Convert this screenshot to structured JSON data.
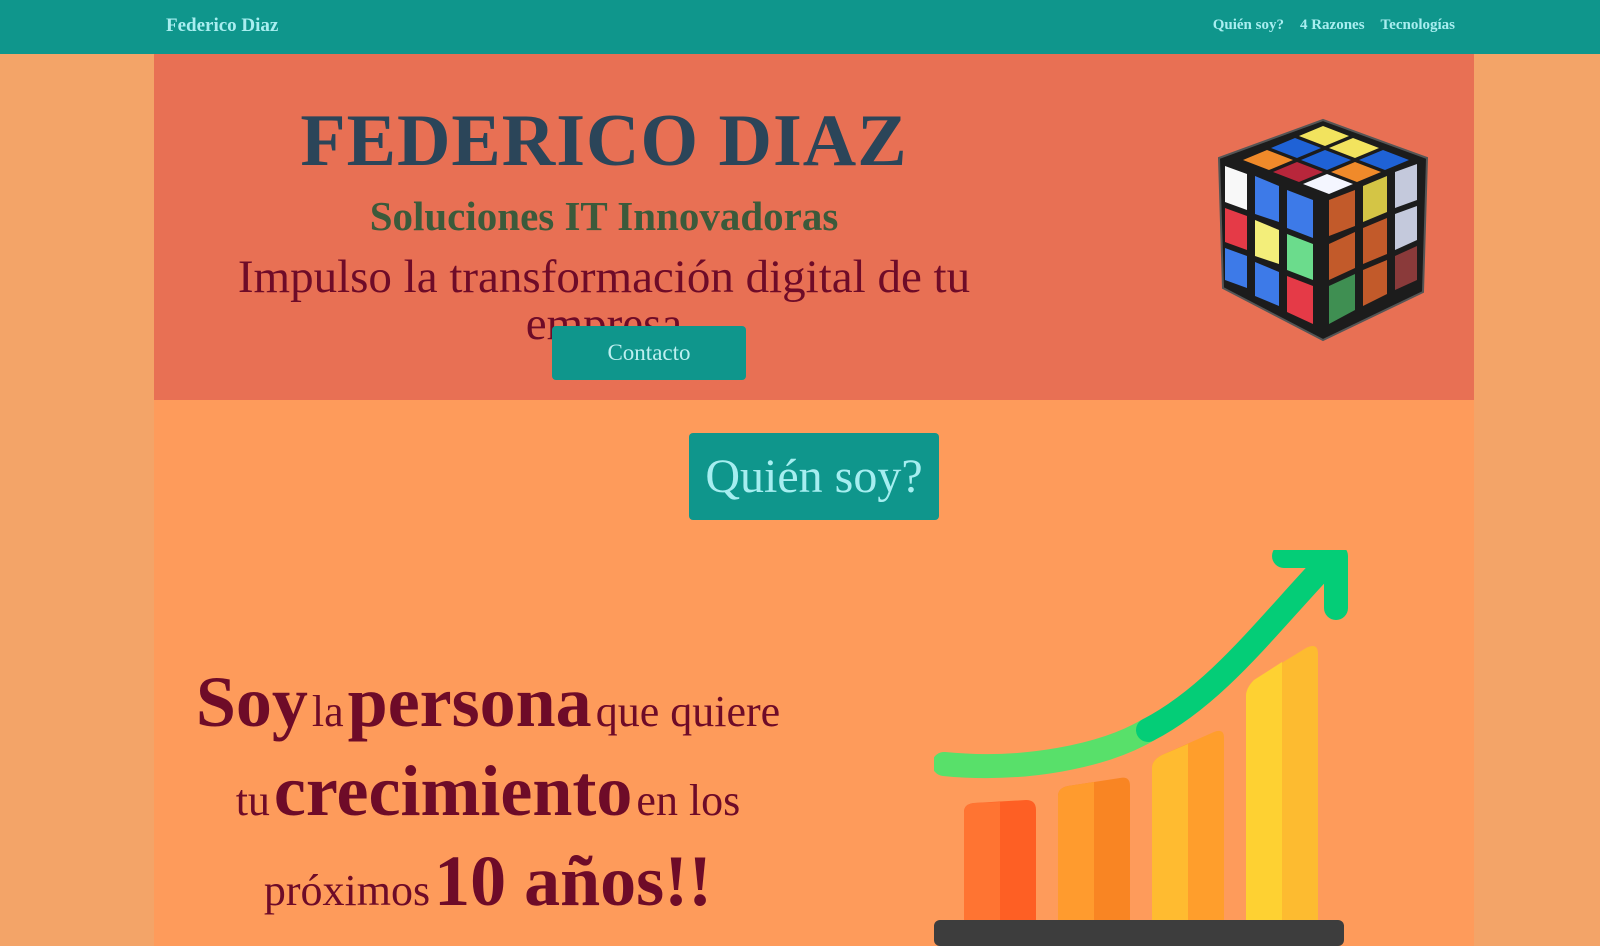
{
  "nav": {
    "brand": "Federico Diaz",
    "links": [
      "Quién soy?",
      "4 Razones",
      "Tecnologías"
    ]
  },
  "hero": {
    "title": "FEDERICO DIAZ",
    "subtitle": "Soluciones IT Innovadoras",
    "tagline": "Impulso la transformación digital de tu empresa",
    "contact_label": "Contacto",
    "image_icon": "rubiks-cube-icon"
  },
  "about": {
    "section_label": "Quién soy?",
    "statement": {
      "w1": "Soy",
      "w2": "la",
      "w3": "persona",
      "w4": "que quiere",
      "w5": "tu",
      "w6": "crecimiento",
      "w7": "en los",
      "w8": "próximos",
      "w9": "10 años!!"
    },
    "image_icon": "growth-chart-icon"
  },
  "colors": {
    "nav_bg": "#0f968c",
    "hero_bg": "#e87054",
    "about_bg": "#fe9b5b",
    "page_bg": "#f3a468",
    "accent_text": "#6e0b28"
  }
}
